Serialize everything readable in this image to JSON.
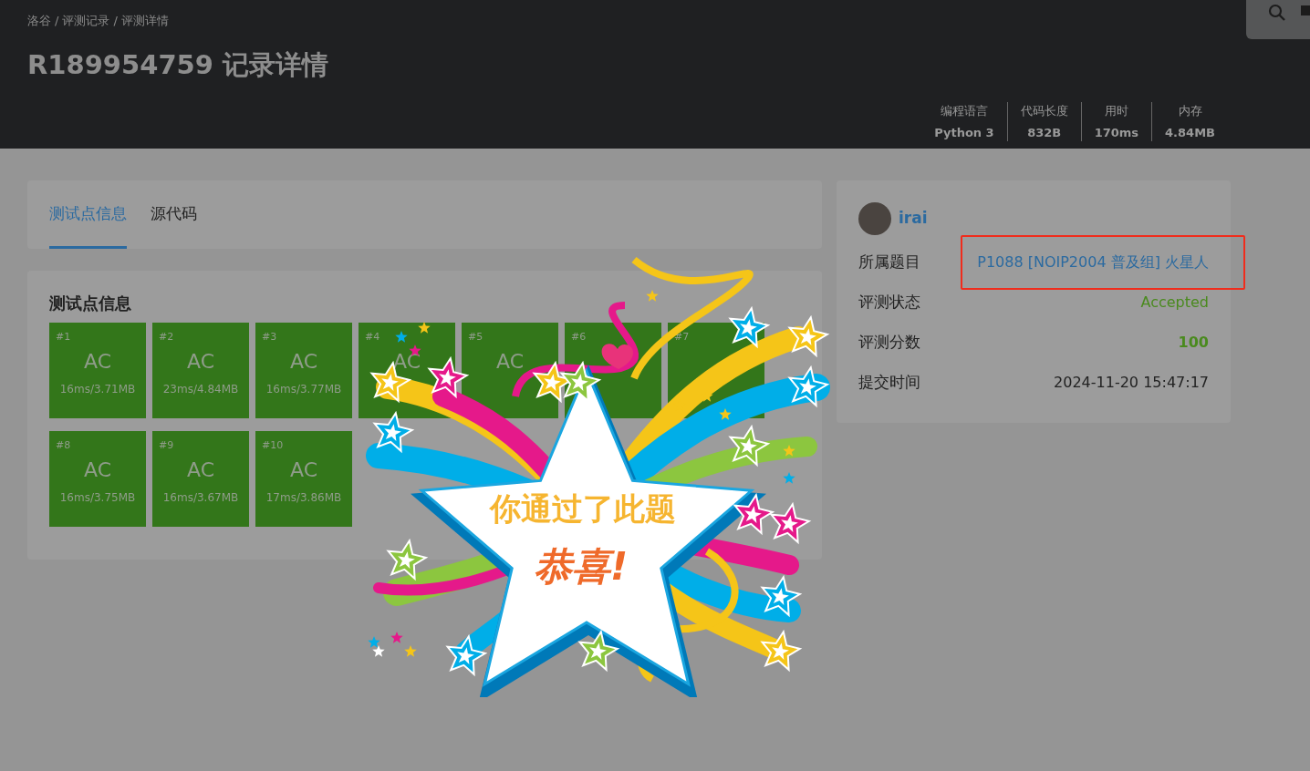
{
  "breadcrumb": {
    "items": [
      "洛谷",
      "评测记录",
      "评测详情"
    ],
    "separator": "/"
  },
  "title": "R189954759 记录详情",
  "stats": [
    {
      "label": "编程语言",
      "value": "Python 3"
    },
    {
      "label": "代码长度",
      "value": "832B"
    },
    {
      "label": "用时",
      "value": "170ms"
    },
    {
      "label": "内存",
      "value": "4.84MB"
    }
  ],
  "tabs": [
    {
      "label": "测试点信息",
      "selected": true
    },
    {
      "label": "源代码",
      "selected": false
    }
  ],
  "testcases": {
    "heading": "测试点信息",
    "cases": [
      {
        "id": "#1",
        "verdict": "AC",
        "stats": "16ms/3.71MB"
      },
      {
        "id": "#2",
        "verdict": "AC",
        "stats": "23ms/4.84MB"
      },
      {
        "id": "#3",
        "verdict": "AC",
        "stats": "16ms/3.77MB"
      },
      {
        "id": "#4",
        "verdict": "AC"
      },
      {
        "id": "#5",
        "verdict": "AC"
      },
      {
        "id": "#6"
      },
      {
        "id": "#7"
      },
      {
        "id": "#8",
        "verdict": "AC",
        "stats": "16ms/3.75MB"
      },
      {
        "id": "#9",
        "verdict": "AC",
        "stats": "16ms/3.67MB"
      },
      {
        "id": "#10",
        "verdict": "AC",
        "stats": "17ms/3.86MB"
      }
    ]
  },
  "side": {
    "user": "irai",
    "rows": [
      {
        "label": "所属题目",
        "value": "P1088 [NOIP2004 普及组] 火星人",
        "kind": "link",
        "highlighted": true
      },
      {
        "label": "评测状态",
        "value": "Accepted",
        "kind": "status"
      },
      {
        "label": "评测分数",
        "value": "100",
        "kind": "score"
      },
      {
        "label": "提交时间",
        "value": "2024-11-20 15:47:17",
        "kind": "text"
      }
    ]
  },
  "celebration": {
    "line_1": "你通过了此题",
    "line_2": "恭喜!"
  }
}
